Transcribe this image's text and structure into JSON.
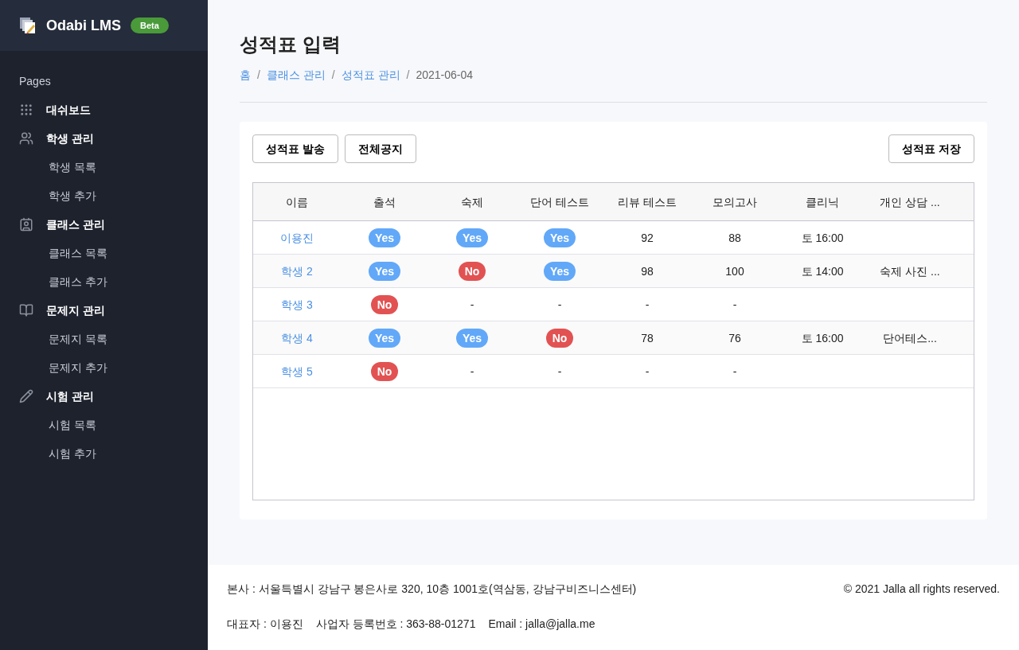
{
  "brand": {
    "name": "Odabi LMS",
    "badge": "Beta"
  },
  "sidebar": {
    "heading": "Pages",
    "sections": [
      {
        "label": "대쉬보드"
      },
      {
        "label": "학생 관리",
        "children": [
          {
            "label": "학생 목록"
          },
          {
            "label": "학생 추가"
          }
        ]
      },
      {
        "label": "클래스 관리",
        "children": [
          {
            "label": "클래스 목록"
          },
          {
            "label": "클래스 추가"
          }
        ]
      },
      {
        "label": "문제지 관리",
        "children": [
          {
            "label": "문제지 목록"
          },
          {
            "label": "문제지 추가"
          }
        ]
      },
      {
        "label": "시험 관리",
        "children": [
          {
            "label": "시험 목록"
          },
          {
            "label": "시험 추가"
          }
        ]
      }
    ]
  },
  "page": {
    "title": "성적표 입력",
    "breadcrumb": [
      {
        "label": "홈",
        "link": true
      },
      {
        "label": "클래스 관리",
        "link": true
      },
      {
        "label": "성적표 관리",
        "link": true
      },
      {
        "label": "2021-06-04",
        "link": false
      }
    ],
    "separator": "/"
  },
  "toolbar": {
    "left": [
      "성적표 발송",
      "전체공지"
    ],
    "right": [
      "성적표 저장"
    ]
  },
  "table": {
    "columns": [
      "이름",
      "출석",
      "숙제",
      "단어 테스트",
      "리뷰 테스트",
      "모의고사",
      "클리닉",
      "개인 상담 ..."
    ],
    "rows": [
      {
        "cells": [
          {
            "kind": "link",
            "text": "이용진"
          },
          {
            "kind": "badge",
            "text": "Yes",
            "positive": true
          },
          {
            "kind": "badge",
            "text": "Yes",
            "positive": true
          },
          {
            "kind": "badge",
            "text": "Yes",
            "positive": true
          },
          {
            "kind": "text",
            "text": "92"
          },
          {
            "kind": "text",
            "text": "88"
          },
          {
            "kind": "text",
            "text": "토 16:00"
          },
          {
            "kind": "empty"
          }
        ]
      },
      {
        "cells": [
          {
            "kind": "link",
            "text": "학생 2"
          },
          {
            "kind": "badge",
            "text": "Yes",
            "positive": true
          },
          {
            "kind": "badge",
            "text": "No",
            "positive": false
          },
          {
            "kind": "badge",
            "text": "Yes",
            "positive": true
          },
          {
            "kind": "text",
            "text": "98"
          },
          {
            "kind": "text",
            "text": "100"
          },
          {
            "kind": "text",
            "text": "토 14:00"
          },
          {
            "kind": "text",
            "text": "숙제 사진 ..."
          }
        ]
      },
      {
        "cells": [
          {
            "kind": "link",
            "text": "학생 3"
          },
          {
            "kind": "badge",
            "text": "No",
            "positive": false
          },
          {
            "kind": "text",
            "text": "-"
          },
          {
            "kind": "text",
            "text": "-"
          },
          {
            "kind": "text",
            "text": "-"
          },
          {
            "kind": "text",
            "text": "-"
          },
          {
            "kind": "empty"
          },
          {
            "kind": "empty"
          }
        ]
      },
      {
        "cells": [
          {
            "kind": "link",
            "text": "학생 4"
          },
          {
            "kind": "badge",
            "text": "Yes",
            "positive": true
          },
          {
            "kind": "badge",
            "text": "Yes",
            "positive": true
          },
          {
            "kind": "badge",
            "text": "No",
            "positive": false
          },
          {
            "kind": "text",
            "text": "78"
          },
          {
            "kind": "text",
            "text": "76"
          },
          {
            "kind": "text",
            "text": "토 16:00"
          },
          {
            "kind": "text",
            "text": "단어테스..."
          }
        ]
      },
      {
        "cells": [
          {
            "kind": "link",
            "text": "학생 5"
          },
          {
            "kind": "badge",
            "text": "No",
            "positive": false
          },
          {
            "kind": "text",
            "text": "-"
          },
          {
            "kind": "text",
            "text": "-"
          },
          {
            "kind": "text",
            "text": "-"
          },
          {
            "kind": "text",
            "text": "-"
          },
          {
            "kind": "empty"
          },
          {
            "kind": "empty"
          }
        ]
      }
    ]
  },
  "footer": {
    "address": "본사 : 서울특별시 강남구 봉은사로 320, 10층 1001호(역삼동, 강남구비즈니스센터)",
    "copyright": "© 2021 Jalla all rights reserved.",
    "details": [
      "대표자 : 이용진",
      "사업자 등록번호 : 363-88-01271",
      "Email : jalla@jalla.me"
    ]
  }
}
